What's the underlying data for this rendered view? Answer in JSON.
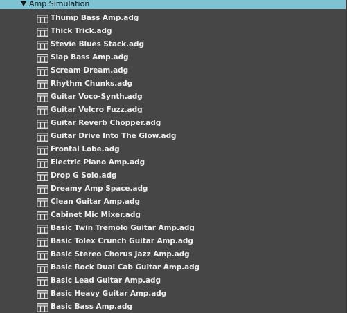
{
  "folder": {
    "label": "Amp Simulation",
    "expanded": true
  },
  "items": [
    {
      "label": "Thump Bass Amp.adg"
    },
    {
      "label": "Thick Trick.adg"
    },
    {
      "label": "Stevie Blues Stack.adg"
    },
    {
      "label": "Slap Bass Amp.adg"
    },
    {
      "label": "Scream Dream.adg"
    },
    {
      "label": "Rhythm Chunks.adg"
    },
    {
      "label": "Guitar Voco-Synth.adg"
    },
    {
      "label": "Guitar Velcro Fuzz.adg"
    },
    {
      "label": "Guitar Reverb Chopper.adg"
    },
    {
      "label": "Guitar Drive Into The Glow.adg"
    },
    {
      "label": "Frontal Lobe.adg"
    },
    {
      "label": "Electric Piano Amp.adg"
    },
    {
      "label": "Drop G Solo.adg"
    },
    {
      "label": "Dreamy Amp Space.adg"
    },
    {
      "label": "Clean Guitar Amp.adg"
    },
    {
      "label": "Cabinet Mic Mixer.adg"
    },
    {
      "label": "Basic Twin Tremolo Guitar Amp.adg"
    },
    {
      "label": "Basic Tolex Crunch Guitar Amp.adg"
    },
    {
      "label": "Basic Stereo Chorus Jazz Amp.adg"
    },
    {
      "label": "Basic Rock Dual Cab Guitar Amp.adg"
    },
    {
      "label": "Basic Lead Guitar Amp.adg"
    },
    {
      "label": "Basic Heavy Guitar Amp.adg"
    },
    {
      "label": "Basic Bass Amp.adg"
    }
  ],
  "colors": {
    "background": "#464646",
    "selected_folder": "#7ec3d3",
    "text": "#eeeeee"
  },
  "icons": {
    "folder_toggle": "triangle-down-icon",
    "item": "audio-effect-rack-icon"
  }
}
